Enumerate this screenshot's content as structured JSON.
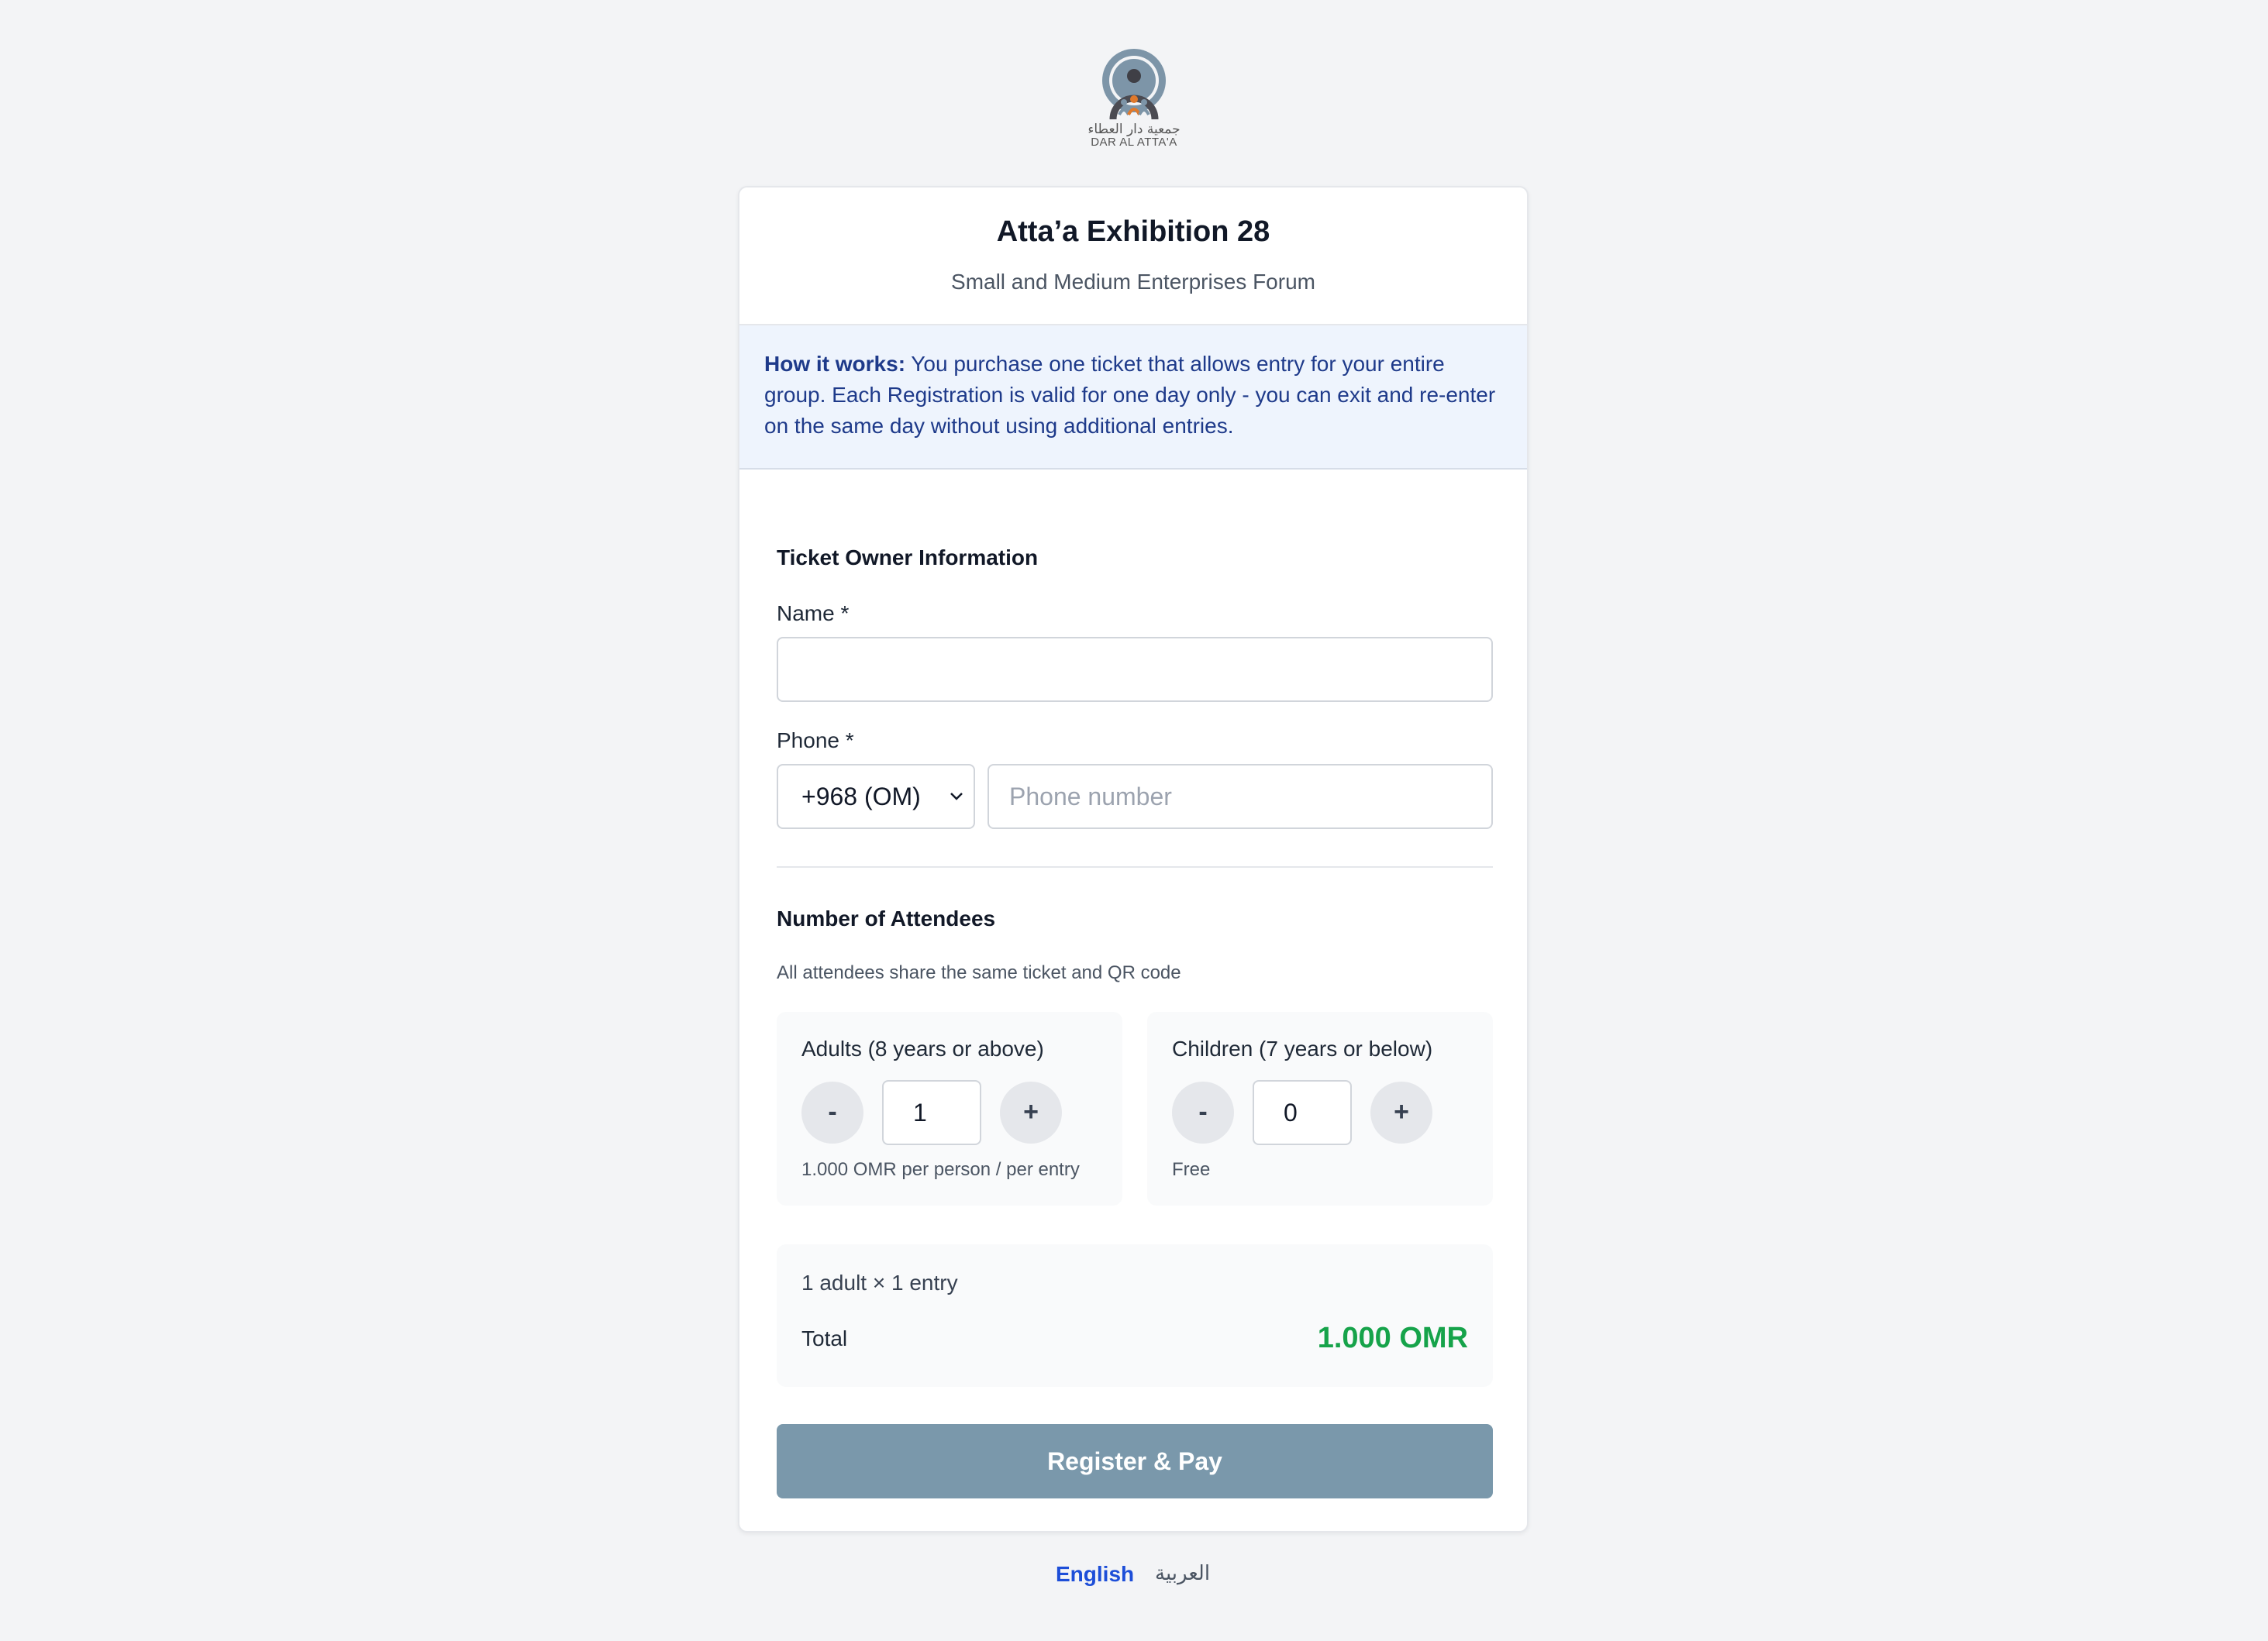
{
  "logo": {
    "arabic_name": "جمعية دار العطاء",
    "latin_name": "DAR AL ATTA'A"
  },
  "event": {
    "title": "Atta’a Exhibition 28",
    "subtitle": "Small and Medium Enterprises Forum"
  },
  "info": {
    "heading": "How it works:",
    "text": " You purchase one ticket that allows entry for your entire group. Each Registration is valid for one day only - you can exit and re-enter on the same day without using additional entries."
  },
  "owner": {
    "section_title": "Ticket Owner Information",
    "name_label": "Name *",
    "name_value": "",
    "phone_label": "Phone *",
    "country_code": "+968 (OM)",
    "phone_placeholder": "Phone number",
    "phone_value": ""
  },
  "attendees": {
    "section_title": "Number of Attendees",
    "hint": "All attendees share the same ticket and QR code",
    "adults": {
      "label": "Adults (8 years or above)",
      "minus": "-",
      "plus": "+",
      "value": "1",
      "note": "1.000 OMR per person / per entry"
    },
    "children": {
      "label": "Children (7 years or below)",
      "minus": "-",
      "plus": "+",
      "value": "0",
      "note": "Free"
    }
  },
  "summary": {
    "line": "1 adult × 1 entry",
    "total_label": "Total",
    "total_value": "1.000 OMR"
  },
  "submit_label": "Register & Pay",
  "languages": {
    "english": "English",
    "arabic": "العربية"
  },
  "colors": {
    "accent_button": "#7a98ab",
    "total_green": "#16a34a",
    "info_background": "#eef4fd",
    "info_text": "#1e3a8a",
    "link_blue": "#1d4ed8"
  }
}
